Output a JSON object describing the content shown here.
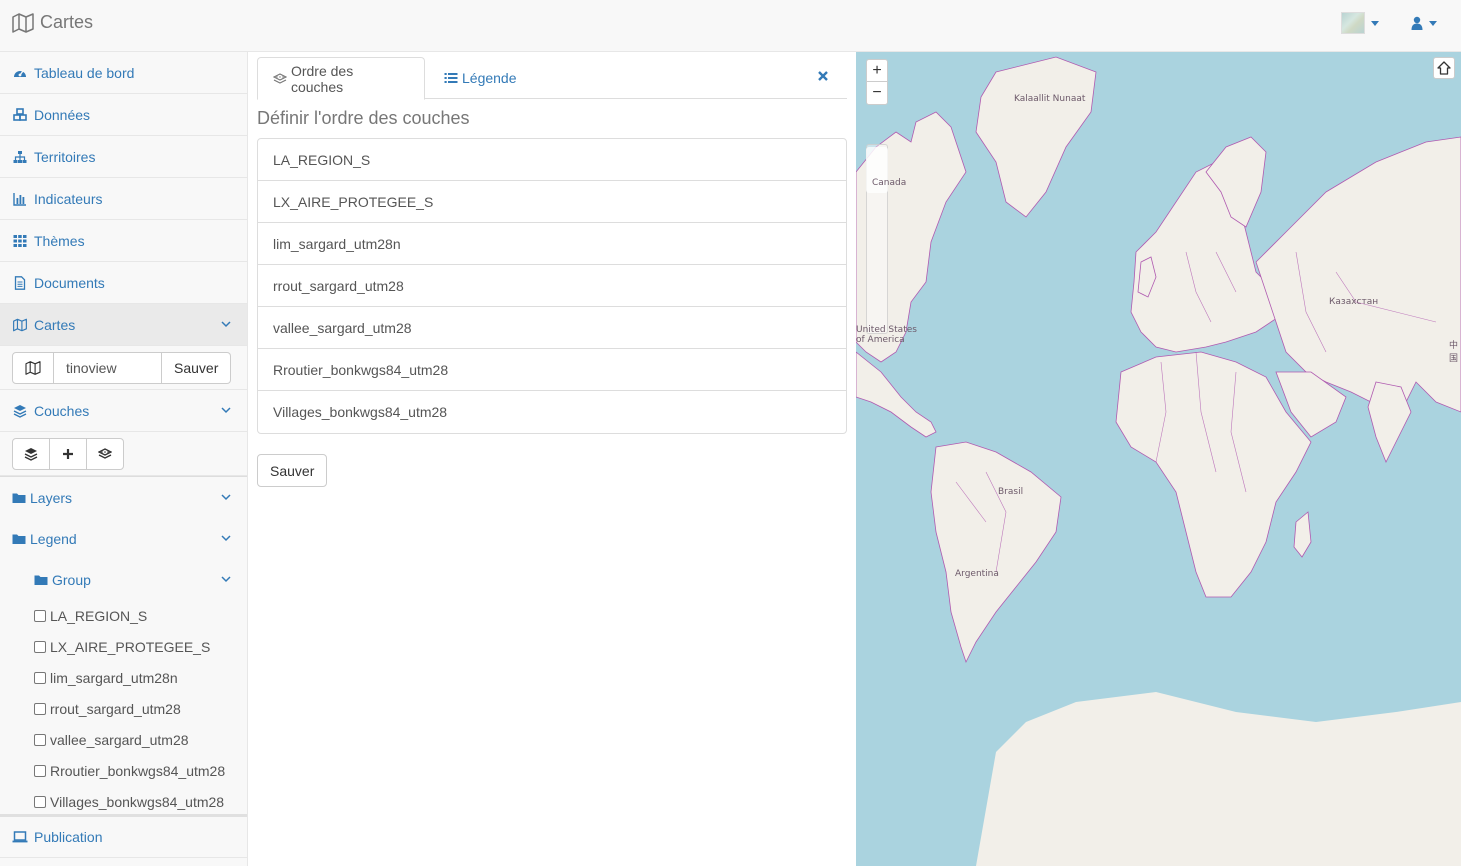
{
  "header": {
    "title": "Cartes",
    "brand_icon": "map-icon",
    "flag_icon": "flag-icon",
    "user_icon": "user-icon"
  },
  "sidebar": {
    "items": [
      {
        "label": "Tableau de bord",
        "icon": "dashboard-icon"
      },
      {
        "label": "Données",
        "icon": "cubes-icon"
      },
      {
        "label": "Territoires",
        "icon": "sitemap-icon"
      },
      {
        "label": "Indicateurs",
        "icon": "bar-chart-icon"
      },
      {
        "label": "Thèmes",
        "icon": "grid-icon"
      },
      {
        "label": "Documents",
        "icon": "document-icon"
      },
      {
        "label": "Cartes",
        "icon": "map-icon"
      }
    ],
    "map_form": {
      "value": "tinoview",
      "save_label": "Sauver"
    },
    "couches": {
      "label": "Couches",
      "icon": "layers-icon"
    },
    "tree": {
      "layers": "Layers",
      "legend": "Legend",
      "group": "Group",
      "leaves": [
        "LA_REGION_S",
        "LX_AIRE_PROTEGEE_S",
        "lim_sargard_utm28n",
        "rrout_sargard_utm28",
        "vallee_sargard_utm28",
        "Rroutier_bonkwgs84_utm28",
        "Villages_bonkwgs84_utm28"
      ]
    },
    "publication": "Publication"
  },
  "main": {
    "tabs": [
      {
        "label": "Ordre des couches",
        "icon": "tag-layers-icon"
      },
      {
        "label": "Légende",
        "icon": "list-icon"
      }
    ],
    "section_title": "Définir l'ordre des couches",
    "order": [
      "LA_REGION_S",
      "LX_AIRE_PROTEGEE_S",
      "lim_sargard_utm28n",
      "rrout_sargard_utm28",
      "vallee_sargard_utm28",
      "Rroutier_bonkwgs84_utm28",
      "Villages_bonkwgs84_utm28"
    ],
    "save_label": "Sauver"
  },
  "map": {
    "zoom_in": "+",
    "zoom_out": "−",
    "labels": {
      "greenland": "Kalaallit Nunaat",
      "canada": "Canada",
      "usa_1": "United States",
      "usa_2": "of America",
      "kazakhstan": "Казахстан",
      "china": "中国",
      "brasil": "Brasil",
      "argentina": "Argentina"
    },
    "colors": {
      "water": "#aad3df",
      "land": "#f2efe9",
      "border": "#b05ab0"
    }
  }
}
